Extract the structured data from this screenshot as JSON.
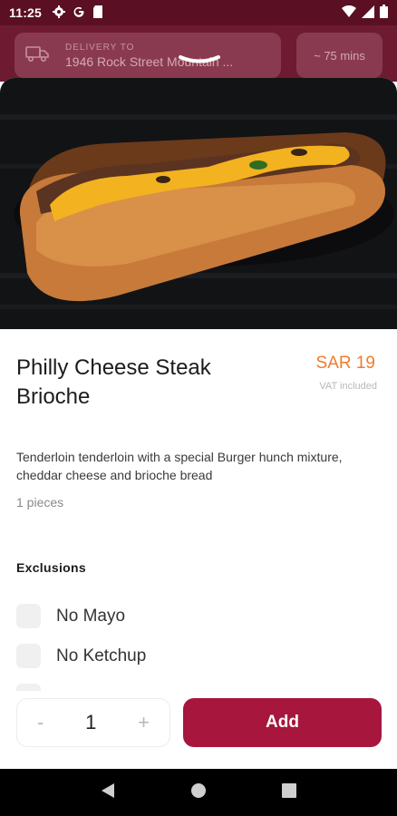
{
  "status_bar": {
    "time": "11:25"
  },
  "header": {
    "delivery_label": "DELIVERY TO",
    "delivery_address": "1946 Rock Street Mountain ...",
    "eta": "~ 75 mins"
  },
  "product": {
    "title": "Philly Cheese Steak Brioche",
    "price": "SAR 19",
    "vat_note": "VAT included",
    "description": "Tenderloin tenderloin with a special Burger hunch mixture, cheddar cheese and brioche bread",
    "pieces": "1 pieces"
  },
  "exclusions": {
    "title": "Exclusions",
    "options": [
      {
        "label": "No Mayo",
        "checked": false
      },
      {
        "label": "No Ketchup",
        "checked": false
      },
      {
        "label": "",
        "checked": false
      }
    ]
  },
  "cart": {
    "minus": "-",
    "quantity": "1",
    "plus": "+",
    "add_label": "Add"
  },
  "colors": {
    "brand": "#a6163d",
    "price": "#f07b2c",
    "status_bar": "#5a0f22"
  }
}
